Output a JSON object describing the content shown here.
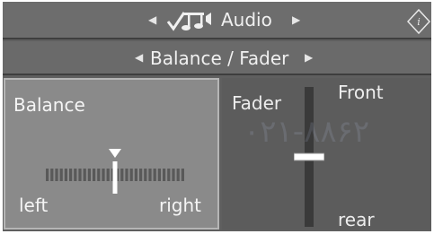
{
  "header": {
    "title": "Audio",
    "icon": "audio-note-icon",
    "info_icon": "info-icon"
  },
  "subheader": {
    "title": "Balance / Fader"
  },
  "balance": {
    "label": "Balance",
    "left_label": "left",
    "right_label": "right",
    "level": 0.5
  },
  "fader": {
    "label": "Fader",
    "front_label": "Front",
    "rear_label": "rear",
    "level": 0.5
  },
  "watermark": "۰۲۱-۸۸۶۲",
  "colors": {
    "panel_background": "#5f5f5f",
    "selected_panel": "#8a8a8a",
    "text": "#f2f2f2"
  }
}
